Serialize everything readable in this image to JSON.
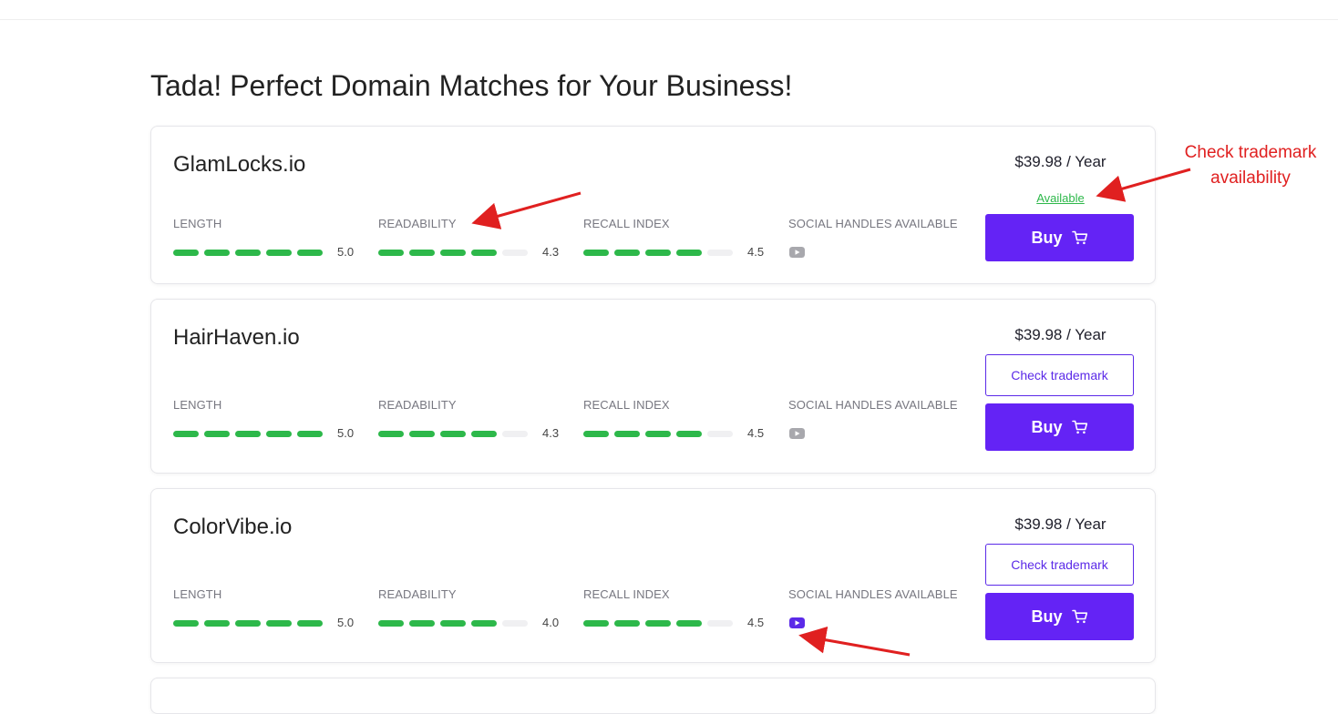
{
  "page": {
    "title": "Tada! Perfect Domain Matches for Your Business!"
  },
  "labels": {
    "length": "LENGTH",
    "readability": "READABILITY",
    "recall": "RECALL INDEX",
    "social": "SOCIAL HANDLES AVAILABLE",
    "buy": "Buy",
    "check_trademark": "Check trademark",
    "available": "Available"
  },
  "colors": {
    "accent": "#6423f5",
    "bar_on": "#2db84a",
    "bar_off": "#f0f0f2",
    "icon_inactive": "#a8a8ad",
    "icon_active": "#5b2ae8",
    "annotation": "#e02020"
  },
  "domains": [
    {
      "name": "GlamLocks.io",
      "price": "$39.98 / Year",
      "trademark_status": "Available",
      "length": {
        "score": "5.0",
        "filled": 5
      },
      "readability": {
        "score": "4.3",
        "filled": 4
      },
      "recall": {
        "score": "4.5",
        "filled": 4
      },
      "social_icon": "youtube-icon",
      "social_active": false
    },
    {
      "name": "HairHaven.io",
      "price": "$39.98 / Year",
      "trademark_status": "check",
      "length": {
        "score": "5.0",
        "filled": 5
      },
      "readability": {
        "score": "4.3",
        "filled": 4
      },
      "recall": {
        "score": "4.5",
        "filled": 4
      },
      "social_icon": "youtube-icon",
      "social_active": false
    },
    {
      "name": "ColorVibe.io",
      "price": "$39.98 / Year",
      "trademark_status": "check",
      "length": {
        "score": "5.0",
        "filled": 5
      },
      "readability": {
        "score": "4.0",
        "filled": 4
      },
      "recall": {
        "score": "4.5",
        "filled": 4
      },
      "social_icon": "youtube-icon",
      "social_active": true
    }
  ],
  "annotation": {
    "line1": "Check trademark",
    "line2": "availability"
  }
}
